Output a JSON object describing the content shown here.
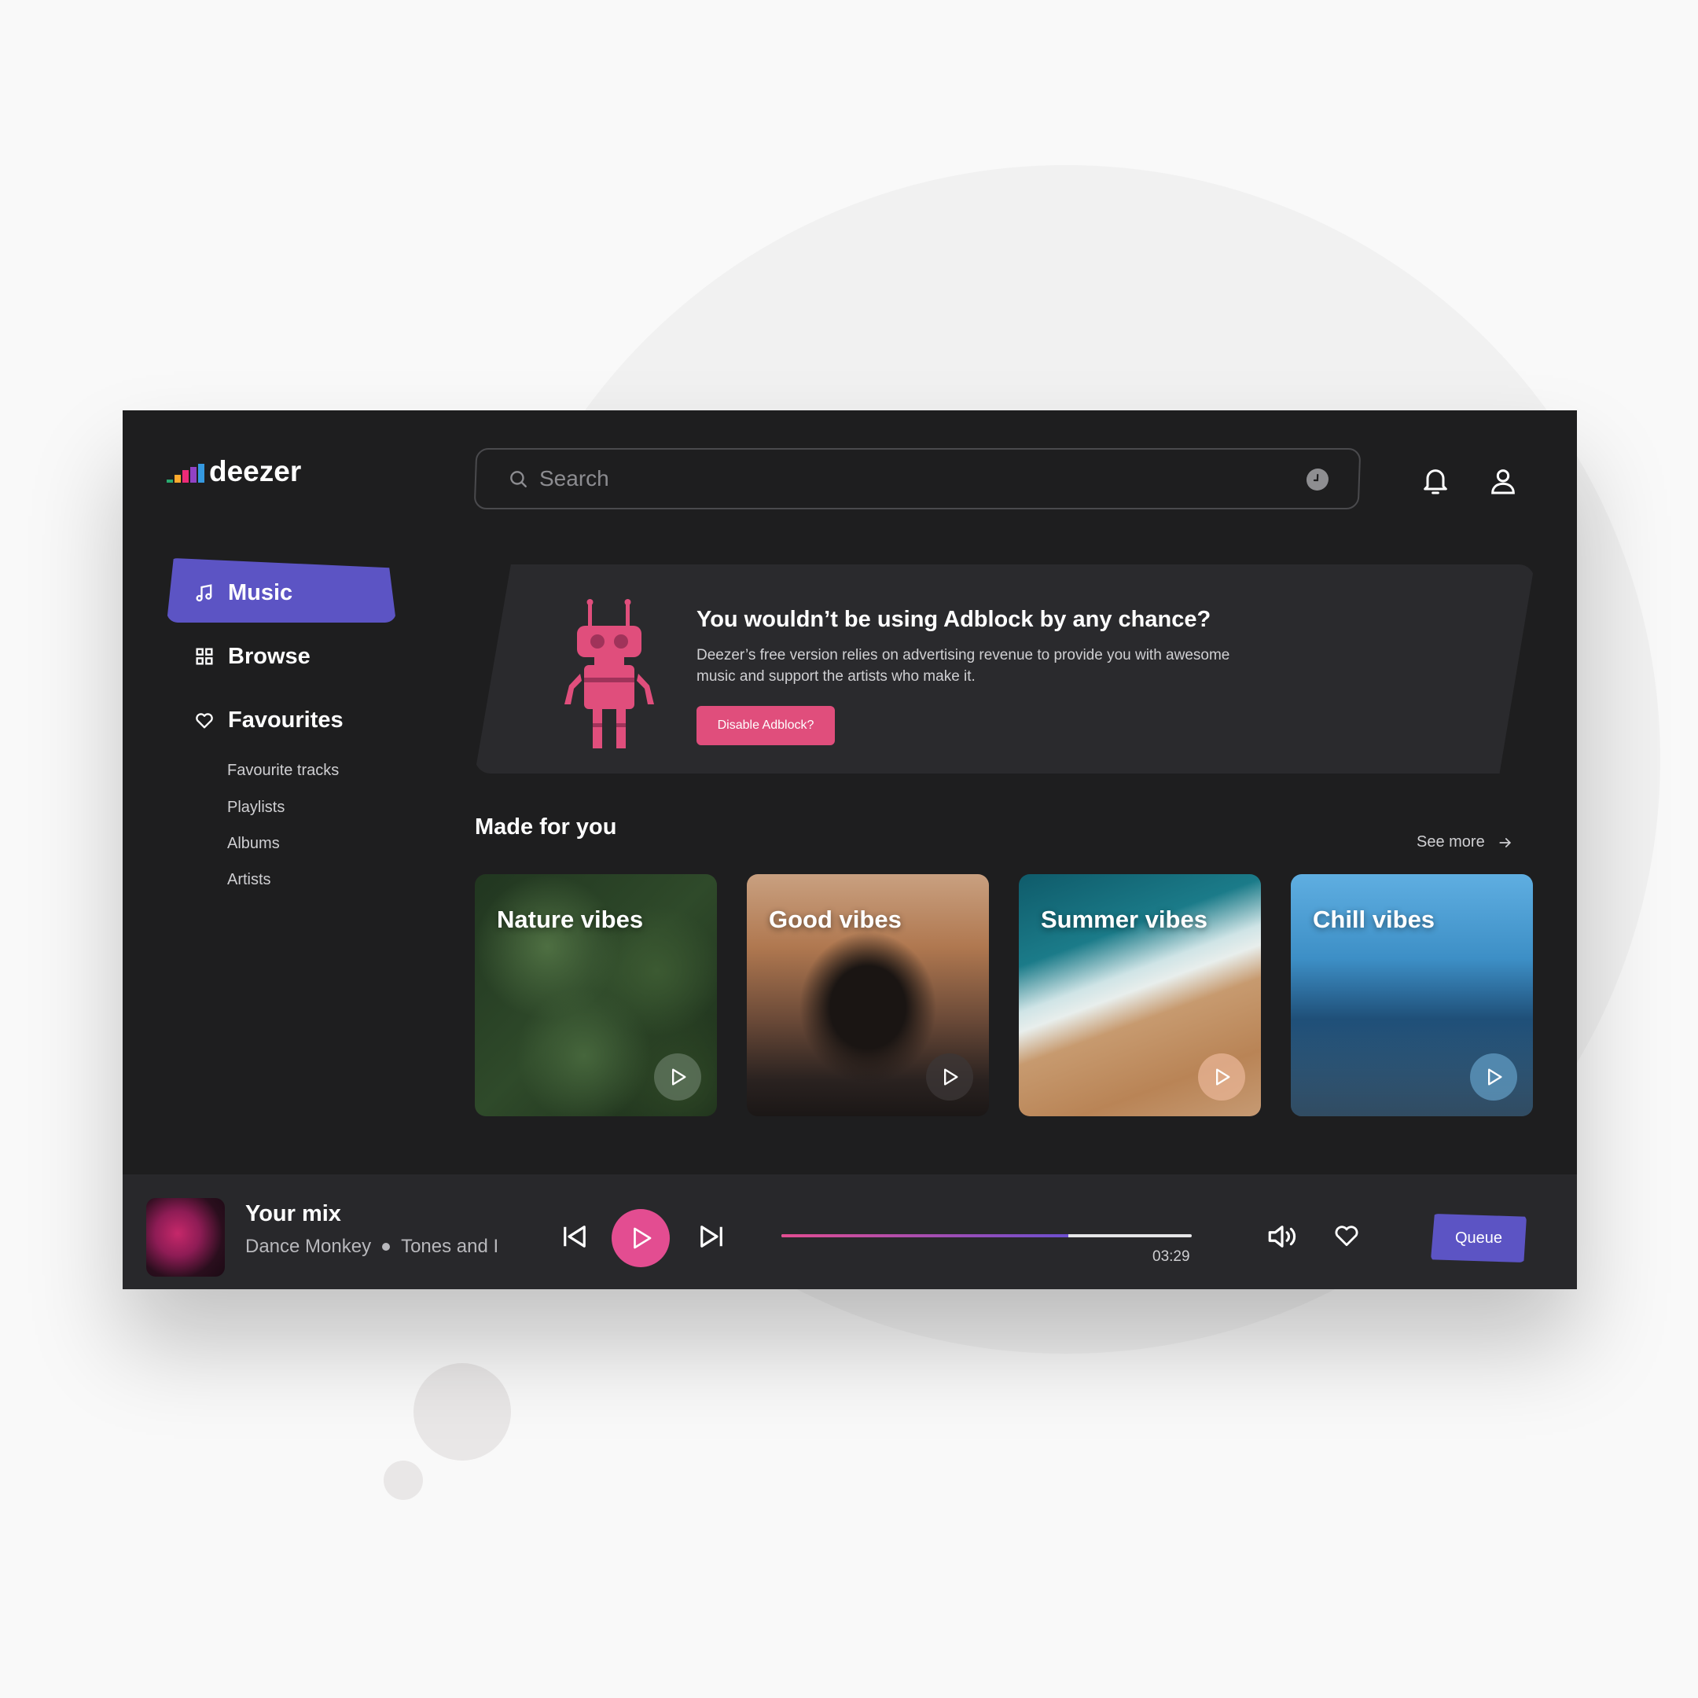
{
  "brand": {
    "name": "deezer",
    "bar_colors": [
      "#29ab70",
      "#feaa2d",
      "#ed2a77",
      "#9142c4",
      "#3599e0"
    ],
    "accent": "#5c54c4",
    "pink": "#e34d91"
  },
  "search": {
    "placeholder": "Search"
  },
  "sidebar": {
    "items": [
      {
        "label": "Music",
        "icon": "music-note-icon",
        "active": true
      },
      {
        "label": "Browse",
        "icon": "grid-icon"
      },
      {
        "label": "Favourites",
        "icon": "heart-icon"
      }
    ],
    "sub_items": [
      "Favourite tracks",
      "Playlists",
      "Albums",
      "Artists"
    ]
  },
  "banner": {
    "title": "You wouldn’t be using Adblock by any chance?",
    "text": "Deezer’s free version relies on advertising revenue to provide you with awesome music and support the artists who make it.",
    "button": "Disable Adblock?",
    "icon": "robot-icon"
  },
  "made_for_you": {
    "title": "Made for you",
    "see_more": "See more",
    "cards": [
      {
        "title": "Nature vibes"
      },
      {
        "title": "Good vibes"
      },
      {
        "title": "Summer vibes"
      },
      {
        "title": "Chill vibes"
      }
    ]
  },
  "player": {
    "title": "Your mix",
    "track": "Dance Monkey",
    "artist": "Tones and I",
    "time": "03:29",
    "progress": 0.7,
    "queue": "Queue"
  }
}
